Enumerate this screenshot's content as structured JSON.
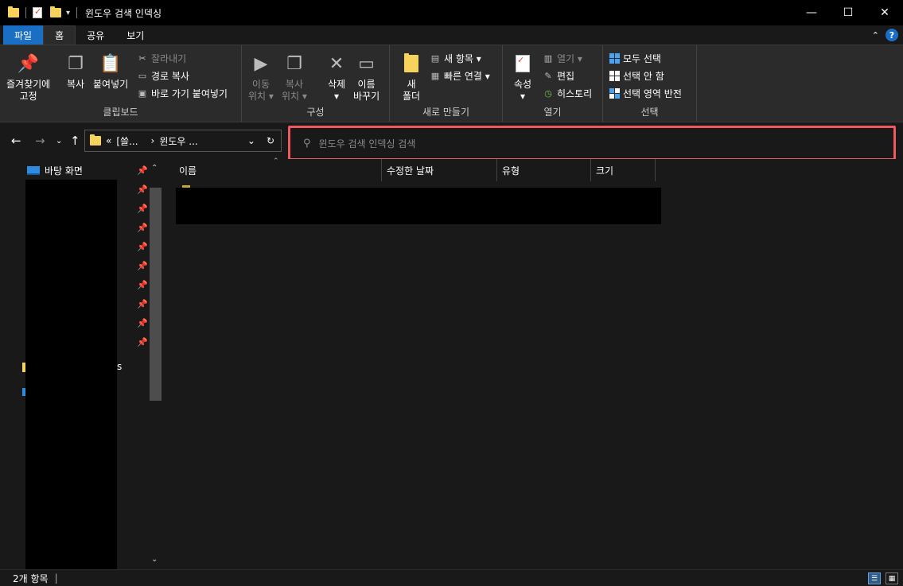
{
  "window": {
    "title": "윈도우 검색 인덱싱",
    "controls": {
      "minimize": "—",
      "maximize": "☐",
      "close": "✕"
    }
  },
  "ribbon_tabs": [
    {
      "label": "파일"
    },
    {
      "label": "홈"
    },
    {
      "label": "공유"
    },
    {
      "label": "보기"
    }
  ],
  "ribbon": {
    "clipboard": {
      "pin": "즐겨찾기에\n고정",
      "copy": "복사",
      "paste": "붙여넣기",
      "cut": "잘라내기",
      "copy_path": "경로 복사",
      "paste_shortcut": "바로 가기 붙여넣기",
      "label": "클립보드"
    },
    "organize": {
      "move_to": "이동\n위치 ▾",
      "copy_to": "복사\n위치 ▾",
      "delete": "삭제\n▾",
      "rename": "이름\n바꾸기",
      "label": "구성"
    },
    "new": {
      "new_folder": "새\n폴더",
      "new_item": "새 항목 ▾",
      "easy_access": "빠른 연결 ▾",
      "label": "새로 만들기"
    },
    "open": {
      "properties": "속성\n▾",
      "open": "열기 ▾",
      "edit": "편집",
      "history": "히스토리",
      "label": "열기"
    },
    "select": {
      "select_all": "모두 선택",
      "select_none": "선택 안 함",
      "invert": "선택 영역 반전",
      "label": "선택"
    }
  },
  "address_bar": {
    "path_prefix": "«",
    "crumb1": "[쓸...",
    "sep": "›",
    "crumb2": "윈도우 ...",
    "dropdown": "⌄",
    "refresh": "↻"
  },
  "search": {
    "placeholder": "윈도우 검색 인덱싱 검색",
    "icon": "⚲"
  },
  "nav_pane": {
    "desktop": "바탕 화면",
    "fragment": "s"
  },
  "columns": [
    {
      "label": "이름"
    },
    {
      "label": "수정한 날짜"
    },
    {
      "label": "유형"
    },
    {
      "label": "크기"
    }
  ],
  "status": {
    "item_count": "2개 항목"
  }
}
